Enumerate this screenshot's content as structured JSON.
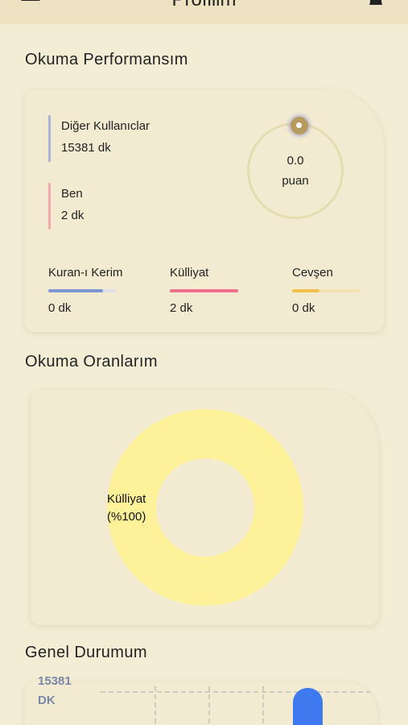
{
  "header": {
    "title": "Profilim"
  },
  "performance": {
    "title": "Okuma Performansım",
    "others": {
      "label": "Diğer Kullanıclar",
      "value": "15381 dk",
      "color": "#a8b4d6"
    },
    "me": {
      "label": "Ben",
      "value": "2  dk",
      "color": "#f0a8ad"
    },
    "score": {
      "value": "0.0",
      "unit": "puan",
      "ring_color": "#e5dcb0",
      "knob_color": "#b79a5e"
    },
    "categories": [
      {
        "name": "Kuran-ı Kerim",
        "value": "0 dk",
        "color": "#7f96d4",
        "fill_fraction": 0.8
      },
      {
        "name": "Külliyat",
        "value": "2 dk",
        "color": "#ee6f8e",
        "fill_fraction": 1.0
      },
      {
        "name": "Cevşen",
        "value": "0 dk",
        "color": "#f2c14e",
        "fill_fraction": 0.4
      }
    ]
  },
  "ratios": {
    "title": "Okuma Oranlarım",
    "slice_label": "Külliyat",
    "slice_percent": "(%100)"
  },
  "chart_data": {
    "type": "pie",
    "categories": [
      "Külliyat"
    ],
    "values": [
      100
    ],
    "colors": [
      "#fdf29a"
    ]
  },
  "general": {
    "title": "Genel Durumum",
    "y_value": "15381",
    "y_unit": "DK",
    "bar_color": "#3e79f0"
  }
}
